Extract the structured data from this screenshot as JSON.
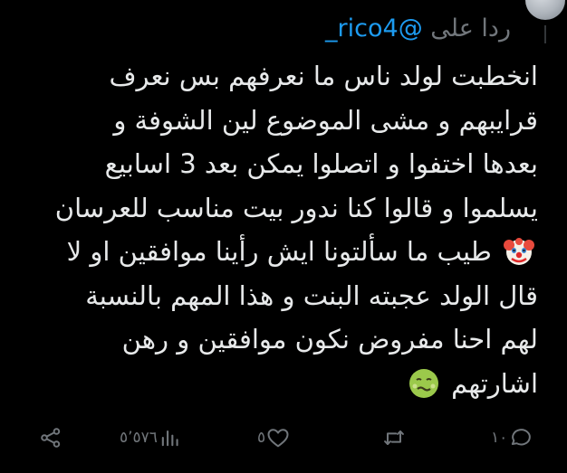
{
  "reply_context": {
    "prefix": "ردا على",
    "handle": "@rico4_"
  },
  "tweet": {
    "lines": [
      "انخطبت لولد ناس ما نعرفهم بس نعرف",
      "قرايبهم و مشى الموضوع لين الشوفة و",
      "بعدها اختفوا و اتصلوا يمكن بعد 3 اسابيع",
      "يسلموا و قالوا كنا ندور بيت مناسب للعرسان",
      "طيب ما سألتونا ايش رأينا موافقين او لا",
      "قال الولد عجبته البنت و هذا المهم بالنسبة",
      "لهم احنا مفروض نكون موافقين و رهن",
      "اشارتهم"
    ],
    "emojis": {
      "line5": "clown-face-emoji",
      "line8": "nauseated-face-emoji"
    }
  },
  "actions": {
    "reply_count": "١٠",
    "retweet_count": "",
    "like_count": "٥",
    "views_count": "٥٬٥٧٦",
    "icons": [
      "reply-icon",
      "retweet-icon",
      "like-icon",
      "views-icon",
      "share-icon"
    ]
  },
  "colors": {
    "background": "#000000",
    "text": "#e7e9ea",
    "muted": "#71767b",
    "link": "#1d9bf0"
  }
}
